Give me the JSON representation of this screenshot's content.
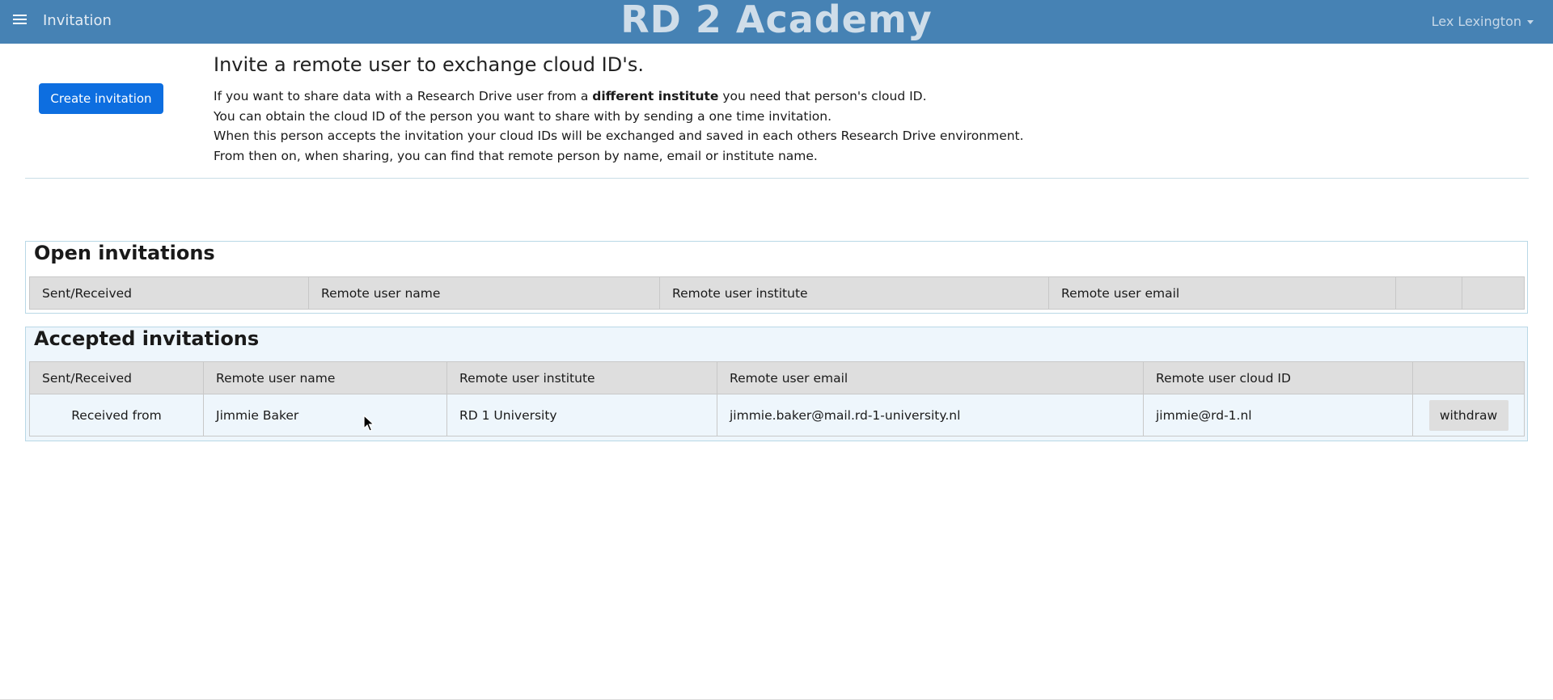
{
  "header": {
    "page_label": "Invitation",
    "app_title": "RD 2 Academy",
    "user_name": "Lex Lexington"
  },
  "intro": {
    "create_button": "Create invitation",
    "heading": "Invite a remote user to exchange cloud ID's.",
    "line1_pre": "If you want to share data with a Research Drive user from a ",
    "line1_bold": "different institute",
    "line1_post": " you need that person's cloud ID.",
    "line2": "You can obtain the cloud ID of the person you want to share with by sending a one time invitation.",
    "line3": "When this person accepts the invitation your cloud IDs will be exchanged and saved in each others Research Drive environment.",
    "line4": "From then on, when sharing, you can find that remote person by name, email or institute name."
  },
  "open_invitations": {
    "title": "Open invitations",
    "columns": [
      "Sent/Received",
      "Remote user name",
      "Remote user institute",
      "Remote user email",
      "",
      ""
    ]
  },
  "accepted_invitations": {
    "title": "Accepted invitations",
    "columns": [
      "Sent/Received",
      "Remote user name",
      "Remote user institute",
      "Remote user email",
      "Remote user cloud ID",
      ""
    ],
    "rows": [
      {
        "direction": "Received from",
        "name": "Jimmie Baker",
        "institute": "RD 1 University",
        "email": "jimmie.baker@mail.rd-1-university.nl",
        "cloud_id": "jimmie@rd-1.nl",
        "action": "withdraw"
      }
    ]
  },
  "colors": {
    "header_bg": "#4682b4",
    "primary_button": "#0d6ee0",
    "accepted_panel_bg": "#eef6fc"
  }
}
